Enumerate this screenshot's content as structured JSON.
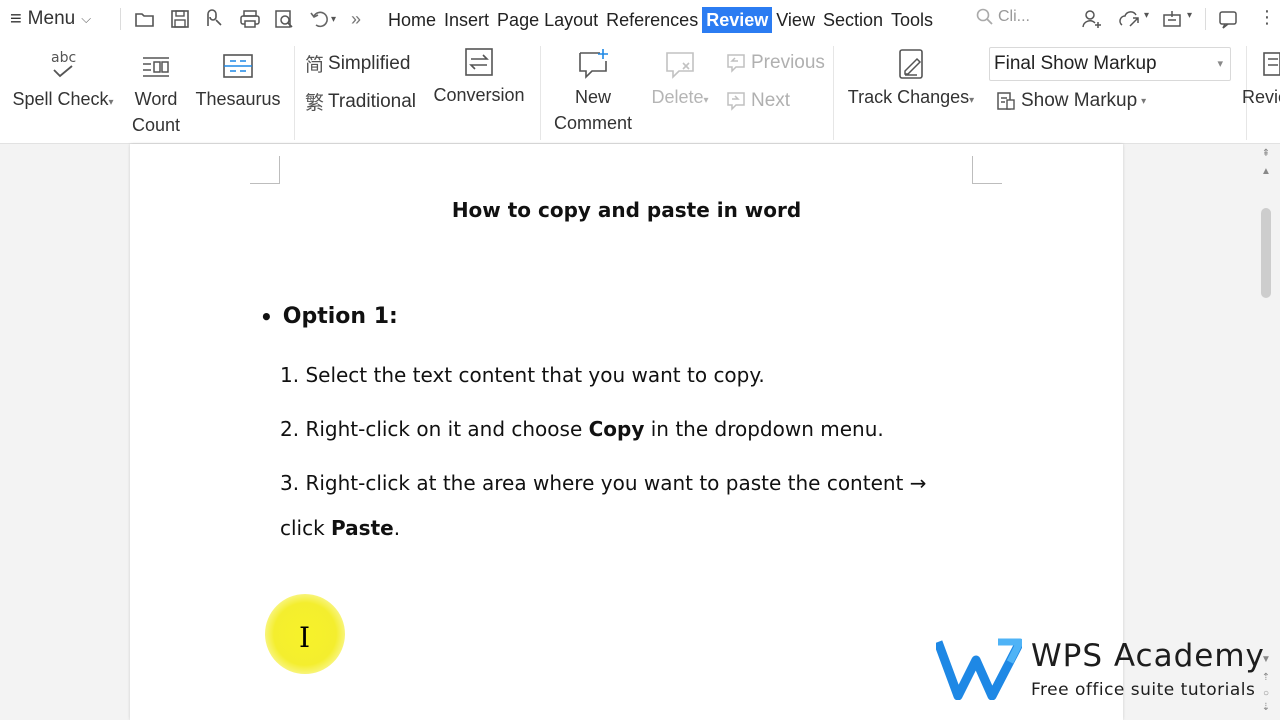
{
  "menubar": {
    "menu_label": "Menu",
    "tabs": [
      {
        "label": "Home"
      },
      {
        "label": "Insert"
      },
      {
        "label": "Page Layout"
      },
      {
        "label": "References"
      },
      {
        "label": "Review",
        "active": true
      },
      {
        "label": "View"
      },
      {
        "label": "Section"
      },
      {
        "label": "Tools"
      }
    ],
    "search_text": "Cli..."
  },
  "ribbon": {
    "spell_check": "Spell Check",
    "spell_check_icon_text": "abc",
    "word_count_line1": "Word",
    "word_count_line2": "Count",
    "thesaurus": "Thesaurus",
    "simplified": "Simplified",
    "traditional": "Traditional",
    "conversion": "Conversion",
    "new_comment_line1": "New",
    "new_comment_line2": "Comment",
    "delete": "Delete",
    "previous": "Previous",
    "next": "Next",
    "track_changes": "Track Changes",
    "markup_dropdown_value": "Final Show Markup",
    "show_markup": "Show Markup",
    "review_partial": "Revie"
  },
  "document": {
    "title": "How to copy and paste in word",
    "option_label": "Option 1:",
    "step1": "1. Select the text content that you want to copy.",
    "step2_prefix": "2. Right-click on it and choose ",
    "step2_bold": "Copy",
    "step2_suffix": " in the dropdown menu.",
    "step3_line1": "3. Right-click at the area where you want to paste the content →",
    "step3_prefix": "click ",
    "step3_bold": "Paste",
    "step3_suffix": "."
  },
  "watermark": {
    "title": "WPS Academy",
    "subtitle": "Free office suite tutorials"
  },
  "colors": {
    "active_tab": "#2b7cf2",
    "logo_blue": "#1e88e5",
    "cursor_highlight": "#f4ee2e"
  }
}
